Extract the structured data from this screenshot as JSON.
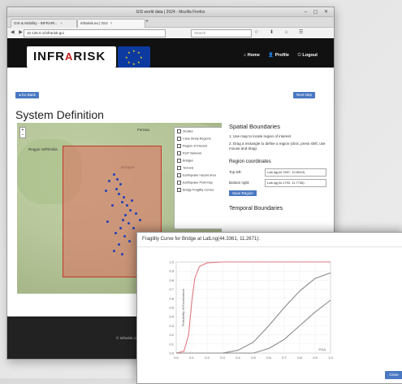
{
  "browser": {
    "window_title": "GIS world data | 2024 - Mozilla Firefox",
    "tabs": [
      {
        "label": "GIS & Mobility - INFRARI..."
      },
      {
        "label": "infrarisk.eu | GUI"
      }
    ],
    "url": "10.125.0.1/infrarisk-gui",
    "search_placeholder": "Search"
  },
  "header": {
    "logo_left": "INFR",
    "logo_arc": "A",
    "logo_right": "RISK",
    "nav": [
      {
        "label": "Home"
      },
      {
        "label": "Profile"
      },
      {
        "label": "Logout"
      }
    ]
  },
  "buttons": {
    "back": "◂ Go Back",
    "next": "Next step"
  },
  "page_title": "System Definition",
  "map": {
    "zoom_in": "+",
    "zoom_out": "−",
    "cities": [
      "Reggio nell'Emilia",
      "Ferrara",
      "Bologna"
    ],
    "layers": [
      {
        "label": "Studies"
      },
      {
        "label": "Case Study Regions"
      },
      {
        "label": "Region of Interest"
      },
      {
        "label": "RoIT Network"
      },
      {
        "label": "Bridges"
      },
      {
        "label": "Tunnels"
      },
      {
        "label": "Earthquake hazard area"
      },
      {
        "label": "Earthquake PGA map"
      },
      {
        "label": "Bridge Fragility Curves"
      }
    ],
    "attribution": "Leaflet | © OSM"
  },
  "spatial": {
    "title": "Spatial Boundaries",
    "steps": [
      "1. Use map to locate region of interest",
      "2. Drag a rectangle to define a region (click, press shift, use mouse and drag)"
    ],
    "region_title": "Region coordinates",
    "top_left_label": "Top left:",
    "top_left_value": "LatLng(44.7897, 10.8043)",
    "bottom_right_label": "Bottom right:",
    "bottom_right_value": "LatLng(44.1793, 11.7748)",
    "save_region": "Save Region",
    "temporal_title": "Temporal Boundaries"
  },
  "footer": {
    "text": "© Infrarisk consortium"
  },
  "popup": {
    "title": "Fragility Curve for Bridge at LatLng(44.3361, 11.2671): ",
    "close": "Close"
  },
  "chart_data": {
    "type": "line",
    "title": "",
    "xlabel": "PGA",
    "ylabel": "Probability of Exceedance",
    "xlim": [
      0,
      1.0
    ],
    "ylim": [
      0,
      1.0
    ],
    "x_ticks": [
      "0.0",
      "0.1",
      "0.2",
      "0.3",
      "0.4",
      "0.5",
      "0.6",
      "0.7",
      "0.8",
      "0.9",
      "1.0"
    ],
    "y_ticks": [
      "0.0",
      "0.1",
      "0.2",
      "0.3",
      "0.4",
      "0.5",
      "0.6",
      "0.7",
      "0.8",
      "0.9",
      "1.0"
    ],
    "series": [
      {
        "color": "#e07a82",
        "values": [
          [
            0,
            0
          ],
          [
            0.05,
            0.02
          ],
          [
            0.08,
            0.2
          ],
          [
            0.1,
            0.55
          ],
          [
            0.12,
            0.82
          ],
          [
            0.15,
            0.95
          ],
          [
            0.2,
            0.99
          ],
          [
            0.3,
            1
          ],
          [
            0.5,
            1
          ],
          [
            0.7,
            1
          ],
          [
            1.0,
            1
          ]
        ]
      },
      {
        "color": "#8a8a8a",
        "values": [
          [
            0,
            0
          ],
          [
            0.3,
            0.0
          ],
          [
            0.4,
            0.03
          ],
          [
            0.5,
            0.12
          ],
          [
            0.6,
            0.3
          ],
          [
            0.7,
            0.5
          ],
          [
            0.8,
            0.68
          ],
          [
            0.9,
            0.82
          ],
          [
            1.0,
            0.88
          ]
        ]
      },
      {
        "color": "#8a8a8a",
        "values": [
          [
            0,
            0
          ],
          [
            0.5,
            0.0
          ],
          [
            0.6,
            0.05
          ],
          [
            0.7,
            0.15
          ],
          [
            0.8,
            0.3
          ],
          [
            0.9,
            0.45
          ],
          [
            1.0,
            0.58
          ]
        ]
      }
    ]
  }
}
